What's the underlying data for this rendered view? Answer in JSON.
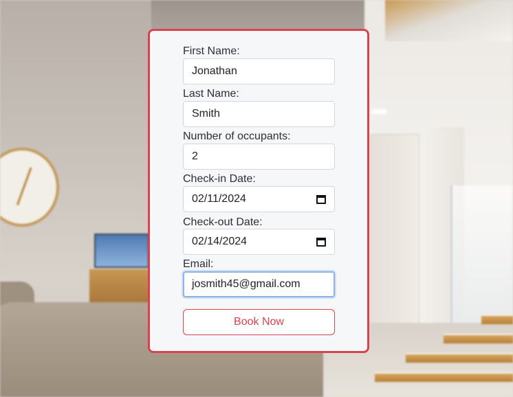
{
  "form": {
    "first_name": {
      "label": "First Name:",
      "value": "Jonathan"
    },
    "last_name": {
      "label": "Last Name:",
      "value": "Smith"
    },
    "occupants": {
      "label": "Number of occupants:",
      "value": "2"
    },
    "check_in": {
      "label": "Check-in Date:",
      "value": "02/11/2024",
      "icon": "calendar-icon"
    },
    "check_out": {
      "label": "Check-out Date:",
      "value": "02/14/2024",
      "icon": "calendar-icon"
    },
    "email": {
      "label": "Email:",
      "value": "josmith45@gmail.com"
    },
    "submit_label": "Book Now"
  },
  "colors": {
    "accent": "#d9434e",
    "card_background": "#f6f7f9",
    "focus_ring": "#8db4e8"
  }
}
